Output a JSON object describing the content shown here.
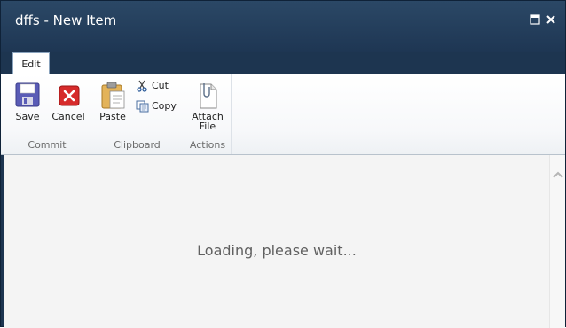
{
  "window": {
    "title": "dffs - New Item"
  },
  "ribbon": {
    "tabs": [
      {
        "label": "Edit"
      }
    ],
    "groups": {
      "commit": {
        "label": "Commit",
        "save": "Save",
        "cancel": "Cancel"
      },
      "clipboard": {
        "label": "Clipboard",
        "paste": "Paste",
        "cut": "Cut",
        "copy": "Copy"
      },
      "actions": {
        "label": "Actions",
        "attach_file": "Attach\nFile"
      }
    }
  },
  "main": {
    "loading_text": "Loading, please wait..."
  },
  "colors": {
    "titlebar": "#1d3550",
    "ribbon_bg": "#f7f8fa",
    "content_bg": "#f4f4f4",
    "text_gray": "#606060"
  }
}
